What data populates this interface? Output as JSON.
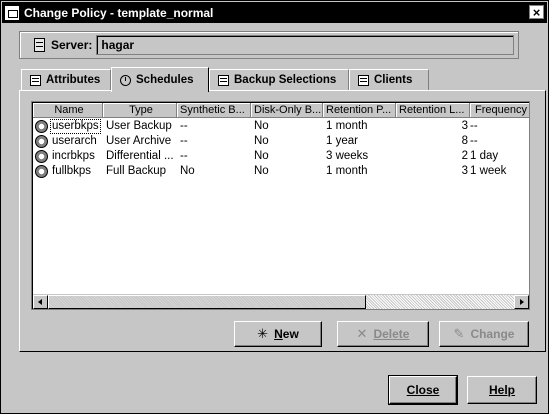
{
  "window": {
    "title": "Change Policy - template_normal"
  },
  "server": {
    "label": "Server:",
    "value": "hagar"
  },
  "tabs": [
    {
      "id": "attributes",
      "label": "Attributes",
      "icon": "list-icon",
      "active": false
    },
    {
      "id": "schedules",
      "label": "Schedules",
      "icon": "clock-icon",
      "active": true
    },
    {
      "id": "backup-selections",
      "label": "Backup Selections",
      "icon": "files-icon",
      "active": false
    },
    {
      "id": "clients",
      "label": "Clients",
      "icon": "computers-icon",
      "active": false
    }
  ],
  "table": {
    "columns": [
      "Name",
      "Type",
      "Synthetic B...",
      "Disk-Only B...",
      "Retention P...",
      "Retention L...",
      "Frequency"
    ],
    "rows": [
      {
        "name": "userbkps",
        "type": "User Backup",
        "synthetic": "--",
        "disk_only": "No",
        "retention_period": "1 month",
        "retention_level": "3",
        "frequency": "--",
        "icon": "schedule-icon"
      },
      {
        "name": "userarch",
        "type": "User Archive",
        "synthetic": "--",
        "disk_only": "No",
        "retention_period": "1 year",
        "retention_level": "8",
        "frequency": "--",
        "icon": "schedule-icon"
      },
      {
        "name": "incrbkps",
        "type": "Differential ...",
        "synthetic": "--",
        "disk_only": "No",
        "retention_period": "3 weeks",
        "retention_level": "2",
        "frequency": "1 day",
        "icon": "schedule-icon"
      },
      {
        "name": "fullbkps",
        "type": "Full Backup",
        "synthetic": "No",
        "disk_only": "No",
        "retention_period": "1 month",
        "retention_level": "3",
        "frequency": "1 week",
        "icon": "schedule-icon"
      }
    ]
  },
  "actions": {
    "new": {
      "label": "New",
      "mnemonic": "N",
      "icon": "sparkle-icon",
      "enabled": true
    },
    "delete": {
      "label": "Delete",
      "mnemonic": "D",
      "icon": "x-icon",
      "enabled": false
    },
    "change": {
      "label": "Change",
      "mnemonic": "g",
      "icon": "pencil-icon",
      "enabled": false
    }
  },
  "dialog": {
    "close": {
      "label": "Close",
      "mnemonic": "C"
    },
    "help": {
      "label": "Help",
      "mnemonic": "H"
    }
  }
}
